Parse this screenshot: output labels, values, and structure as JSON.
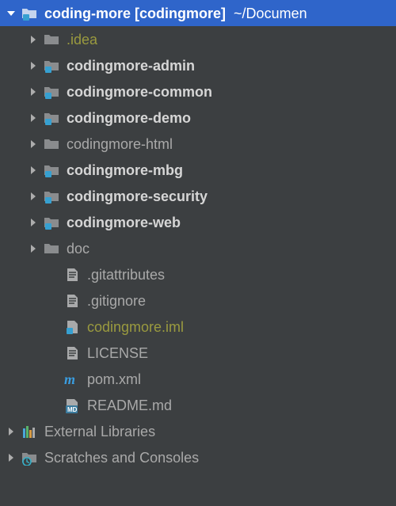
{
  "root": {
    "name": "coding-more",
    "project_bracket": "[codingmore]",
    "path": "~/Documen"
  },
  "children": [
    {
      "label": ".idea",
      "type": "folder",
      "bold": false,
      "olive": true,
      "expandable": true,
      "expanded": false
    },
    {
      "label": "codingmore-admin",
      "type": "module",
      "bold": true,
      "expandable": true,
      "expanded": false
    },
    {
      "label": "codingmore-common",
      "type": "module",
      "bold": true,
      "expandable": true,
      "expanded": false
    },
    {
      "label": "codingmore-demo",
      "type": "module",
      "bold": true,
      "expandable": true,
      "expanded": false
    },
    {
      "label": "codingmore-html",
      "type": "folder",
      "bold": false,
      "expandable": true,
      "expanded": false
    },
    {
      "label": "codingmore-mbg",
      "type": "module",
      "bold": true,
      "expandable": true,
      "expanded": false
    },
    {
      "label": "codingmore-security",
      "type": "module",
      "bold": true,
      "expandable": true,
      "expanded": false
    },
    {
      "label": "codingmore-web",
      "type": "module",
      "bold": true,
      "expandable": true,
      "expanded": false
    },
    {
      "label": "doc",
      "type": "folder",
      "bold": false,
      "expandable": true,
      "expanded": false
    },
    {
      "label": ".gitattributes",
      "type": "file-text",
      "bold": false,
      "expandable": false
    },
    {
      "label": ".gitignore",
      "type": "file-text",
      "bold": false,
      "expandable": false
    },
    {
      "label": "codingmore.iml",
      "type": "file-iml",
      "bold": false,
      "olive": true,
      "expandable": false
    },
    {
      "label": "LICENSE",
      "type": "file-text",
      "bold": false,
      "expandable": false
    },
    {
      "label": "pom.xml",
      "type": "file-pom",
      "bold": false,
      "expandable": false
    },
    {
      "label": "README.md",
      "type": "file-md",
      "bold": false,
      "expandable": false
    }
  ],
  "bottom": [
    {
      "label": "External Libraries",
      "icon": "libs"
    },
    {
      "label": "Scratches and Consoles",
      "icon": "scratches"
    }
  ]
}
